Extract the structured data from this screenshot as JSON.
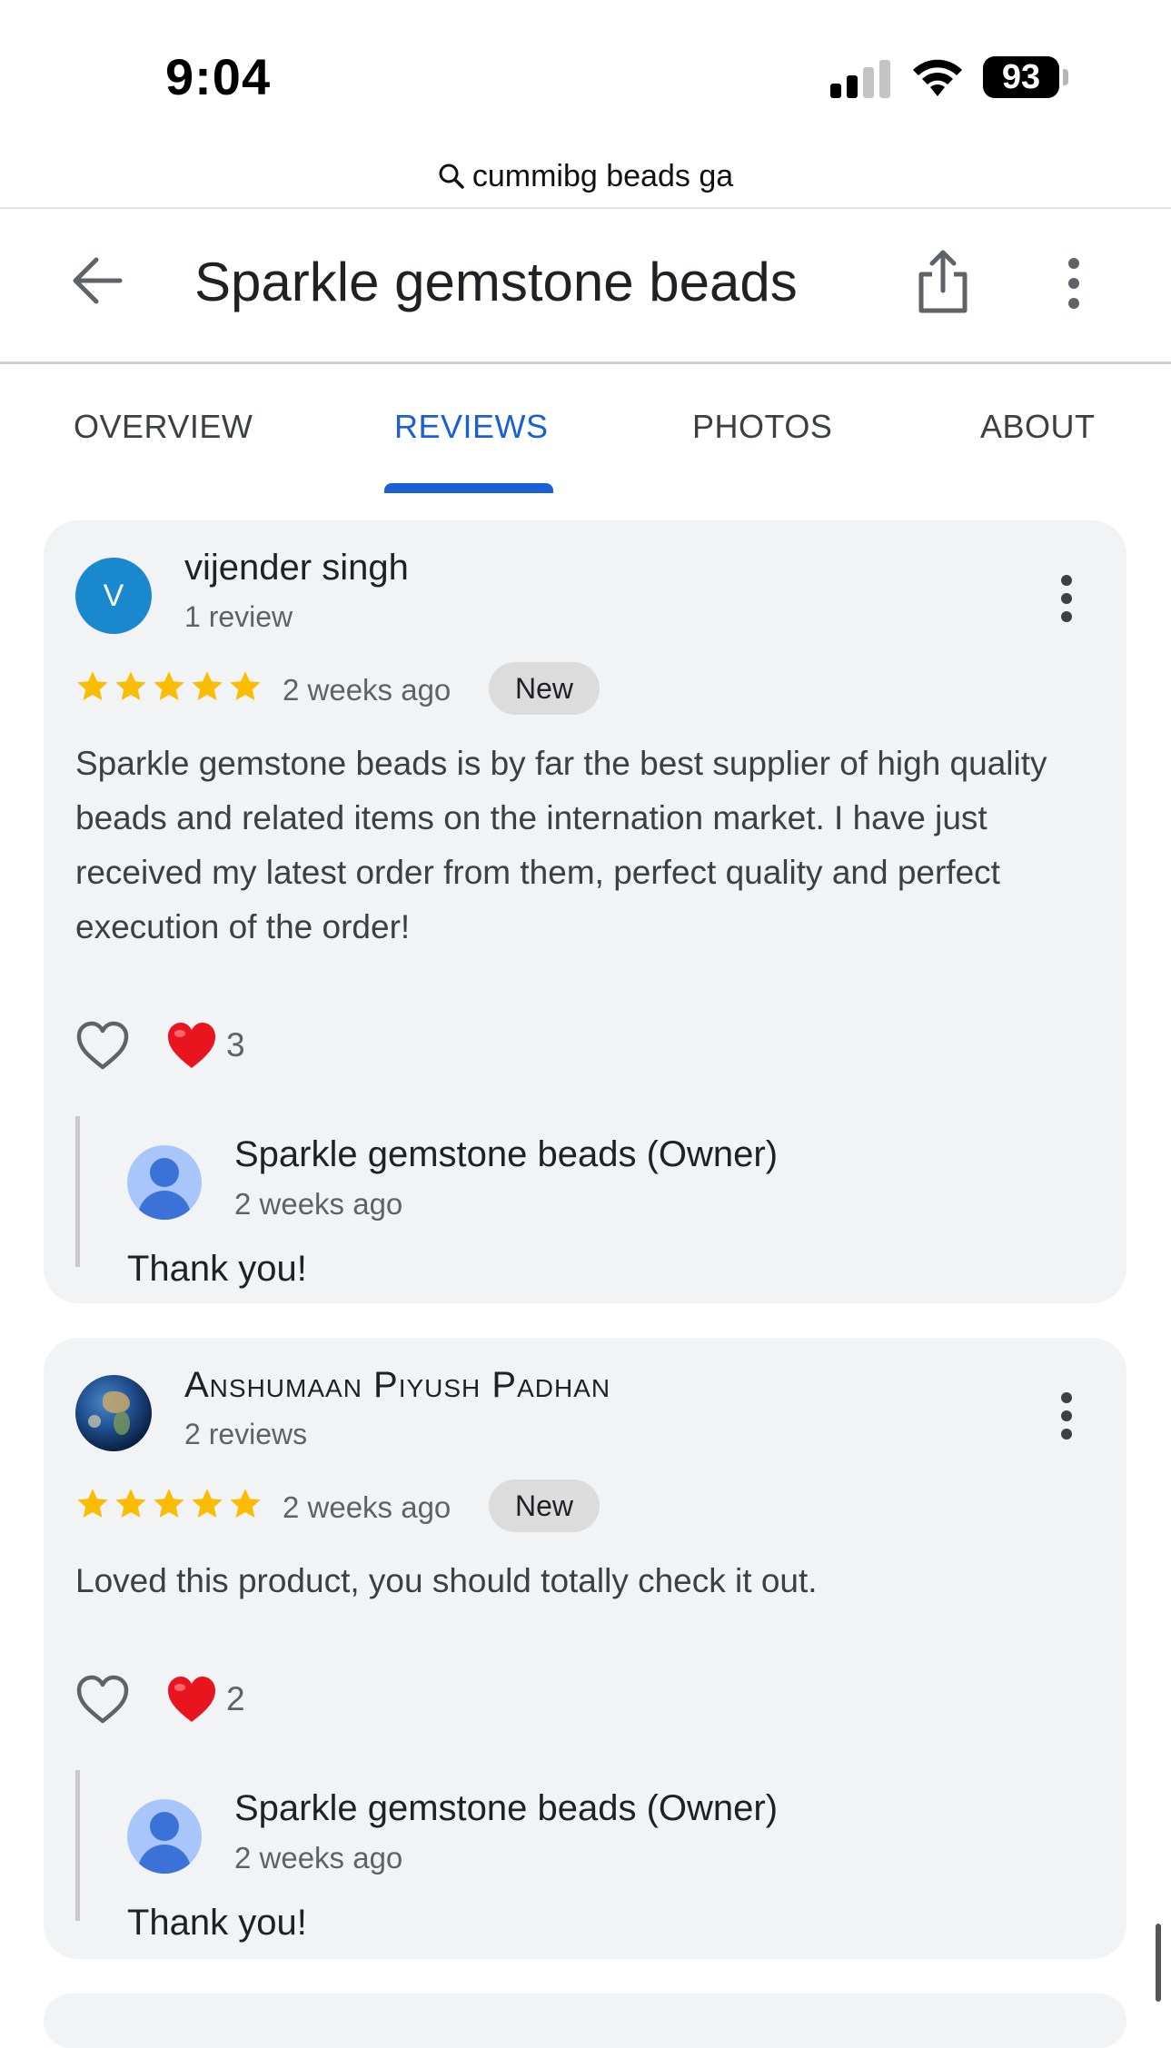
{
  "status_bar": {
    "time": "9:04",
    "battery": "93",
    "icons": [
      "signal-icon",
      "wifi-icon",
      "battery-icon"
    ]
  },
  "url_bar": {
    "query": "cummibg beads ga",
    "icon": "search-icon"
  },
  "header": {
    "title": "Sparkle gemstone beads",
    "icons": [
      "back-arrow-icon",
      "share-icon",
      "more-vertical-icon"
    ]
  },
  "tabs": [
    {
      "label": "OVERVIEW",
      "active": false
    },
    {
      "label": "REVIEWS",
      "active": true
    },
    {
      "label": "PHOTOS",
      "active": false
    },
    {
      "label": "ABOUT",
      "active": false
    }
  ],
  "colors": {
    "accent": "#1a5fd3",
    "star": "#fbbc04",
    "card_bg": "#f1f3f4",
    "heart_red": "#e8151e",
    "avatar_v": "#1a88cf"
  },
  "reviews": [
    {
      "avatar_letter": "V",
      "name": "vijender singh",
      "review_count": "1 review",
      "rating": 5,
      "date": "2 weeks ago",
      "badge": "New",
      "text": "Sparkle gemstone beads is by far the best supplier of high quality beads and related items on the internation market. I have just received my latest order from them, perfect quality and perfect execution of the order!",
      "love_count": "3",
      "owner_reply": {
        "name": "Sparkle gemstone beads (Owner)",
        "date": "2 weeks ago",
        "text": "Thank you!"
      }
    },
    {
      "avatar_letter": "",
      "name": "Anshumaan Piyush Padhan",
      "review_count": "2 reviews",
      "rating": 5,
      "date": "2 weeks ago",
      "badge": "New",
      "text": "Loved this product, you should totally check it out.",
      "love_count": "2",
      "owner_reply": {
        "name": "Sparkle gemstone beads (Owner)",
        "date": "2 weeks ago",
        "text": "Thank you!"
      }
    }
  ]
}
